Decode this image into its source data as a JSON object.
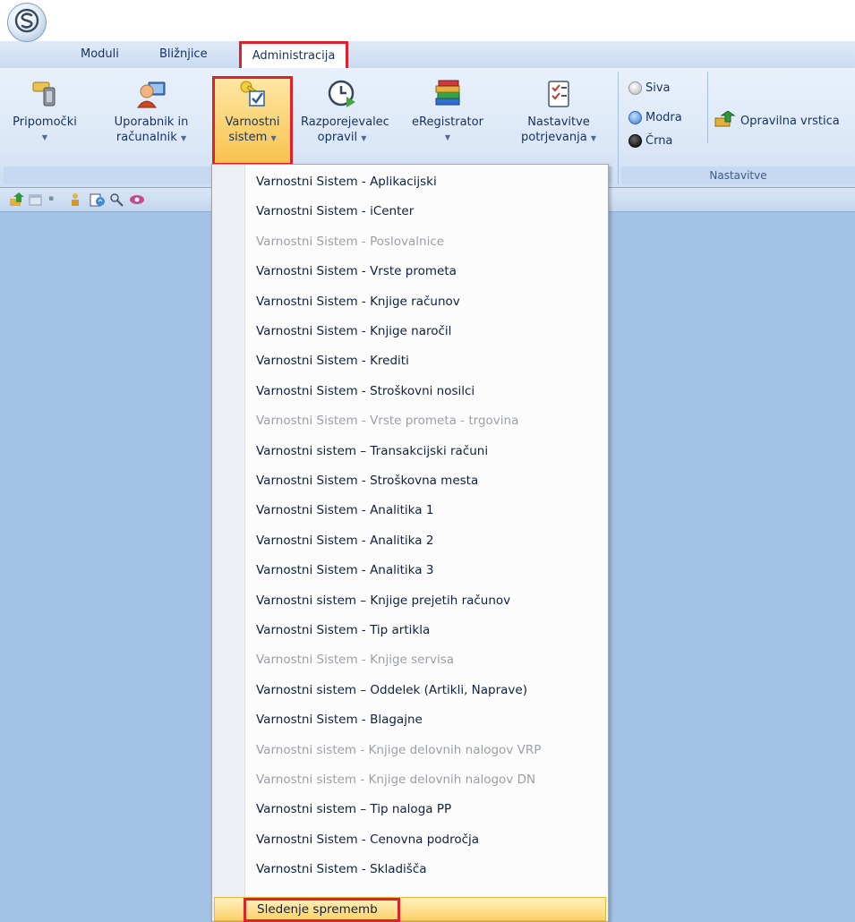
{
  "tabs": [
    {
      "label": "Moduli"
    },
    {
      "label": "Bližnjice"
    },
    {
      "label": "Administracija",
      "active": true
    }
  ],
  "ribbon": {
    "buttons": [
      {
        "line1": "Pripomočki",
        "line2": "",
        "icon": "tools-icon"
      },
      {
        "line1": "Uporabnik in",
        "line2": "računalnik",
        "icon": "user-computer-icon"
      },
      {
        "line1": "Varnostni",
        "line2": "sistem",
        "icon": "security-keys-icon",
        "active": true
      },
      {
        "line1": "Razporejevalec",
        "line2": "opravil",
        "icon": "scheduler-clock-icon"
      },
      {
        "line1": "eRegistrator",
        "line2": "",
        "icon": "books-icon"
      },
      {
        "line1": "Nastavitve",
        "line2": "potrjevanja",
        "icon": "checklist-icon"
      }
    ],
    "themes": [
      {
        "label": "Siva",
        "color": "#c8c8c8"
      },
      {
        "label": "Modra",
        "color": "#4f8fdb"
      },
      {
        "label": "Črna",
        "color": "#1a1a1a"
      }
    ],
    "taskbar_button": "Opravilna vrstica",
    "group_label": "Nastavitve"
  },
  "menu": {
    "items": [
      {
        "label": "Varnostni Sistem - Aplikacijski",
        "enabled": true
      },
      {
        "label": "Varnostni Sistem - iCenter",
        "enabled": true
      },
      {
        "label": "Varnostni Sistem - Poslovalnice",
        "enabled": false
      },
      {
        "label": "Varnostni Sistem - Vrste prometa",
        "enabled": true
      },
      {
        "label": "Varnostni Sistem - Knjige računov",
        "enabled": true
      },
      {
        "label": "Varnostni Sistem - Knjige naročil",
        "enabled": true
      },
      {
        "label": "Varnostni Sistem - Krediti",
        "enabled": true
      },
      {
        "label": "Varnostni Sistem - Stroškovni nosilci",
        "enabled": true
      },
      {
        "label": "Varnostni Sistem - Vrste prometa - trgovina",
        "enabled": false
      },
      {
        "label": "Varnostni sistem – Transakcijski računi",
        "enabled": true
      },
      {
        "label": "Varnostni Sistem - Stroškovna mesta",
        "enabled": true
      },
      {
        "label": "Varnostni Sistem - Analitika 1",
        "enabled": true
      },
      {
        "label": "Varnostni Sistem - Analitika 2",
        "enabled": true
      },
      {
        "label": "Varnostni Sistem - Analitika 3",
        "enabled": true
      },
      {
        "label": "Varnostni sistem – Knjige prejetih računov",
        "enabled": true
      },
      {
        "label": "Varnostni Sistem - Tip artikla",
        "enabled": true
      },
      {
        "label": "Varnostni Sistem - Knjige servisa",
        "enabled": false
      },
      {
        "label": "Varnostni sistem – Oddelek (Artikli, Naprave)",
        "enabled": true
      },
      {
        "label": "Varnostni Sistem - Blagajne",
        "enabled": true
      },
      {
        "label": "Varnostni sistem - Knjige delovnih nalogov VRP",
        "enabled": false
      },
      {
        "label": "Varnostni sistem - Knjige delovnih nalogov DN",
        "enabled": false
      },
      {
        "label": "Varnostni sistem – Tip naloga PP",
        "enabled": true
      },
      {
        "label": "Varnostni Sistem - Cenovna področja",
        "enabled": true
      },
      {
        "label": "Varnostni Sistem - Skladišča",
        "enabled": true
      }
    ],
    "highlighted": "Sledenje sprememb"
  },
  "colors": {
    "accent_red": "#e0202b",
    "menu_text": "#0f2040",
    "disabled_text": "#9a9fa6"
  }
}
